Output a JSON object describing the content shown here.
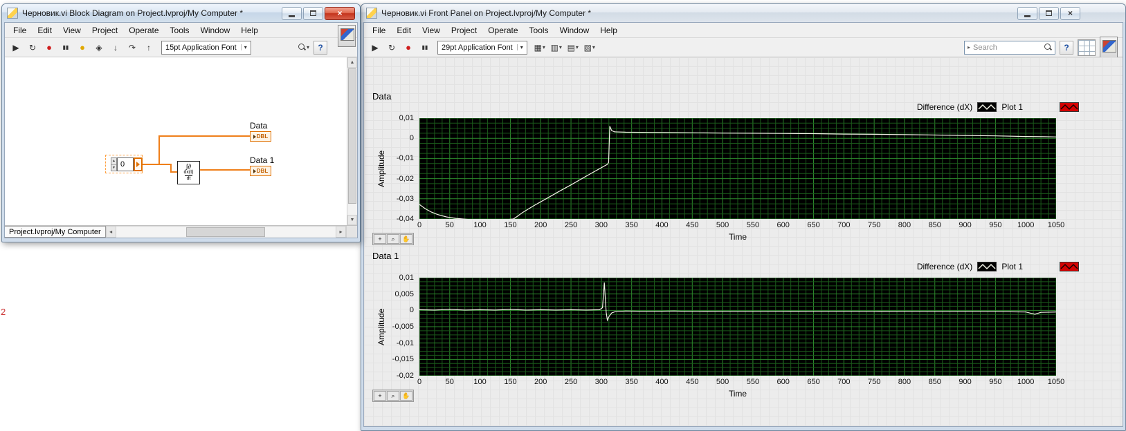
{
  "artifact": {
    "text": "2"
  },
  "block_diagram_window": {
    "title": "Черновик.vi Block Diagram on Project.lvproj/My Computer *",
    "menu": [
      "File",
      "Edit",
      "View",
      "Project",
      "Operate",
      "Tools",
      "Window",
      "Help"
    ],
    "toolbar": {
      "font_selector": "15pt Application Font",
      "icons": [
        "run",
        "run-continuous",
        "abort",
        "pause",
        "highlight-execution",
        "retain-wire-values",
        "step-into",
        "step-over",
        "step-out"
      ],
      "help_label": "?"
    },
    "diagram": {
      "control": {
        "value": "0"
      },
      "derivative_block": {
        "line1": "∫∂",
        "numerator": "dx(t)",
        "denominator": "dt"
      },
      "indicators": [
        {
          "label": "Data",
          "type": "DBL"
        },
        {
          "label": "Data 1",
          "type": "DBL"
        }
      ]
    },
    "bottom_tab": "Project.lvproj/My Computer"
  },
  "front_panel_window": {
    "title": "Черновик.vi Front Panel on Project.lvproj/My Computer *",
    "menu": [
      "File",
      "Edit",
      "View",
      "Project",
      "Operate",
      "Tools",
      "Window",
      "Help"
    ],
    "toolbar": {
      "font_selector": "29pt Application Font",
      "icons": [
        "run",
        "run-continuous",
        "abort",
        "pause"
      ],
      "layout_icons": [
        "align-objects",
        "distribute-objects",
        "text-settings",
        "reorder"
      ],
      "search_placeholder": "Search",
      "help_label": "?"
    }
  },
  "chart_data": [
    {
      "type": "line",
      "title": "Data",
      "xlabel": "Time",
      "ylabel": "Amplitude",
      "xlim": [
        0,
        1050
      ],
      "ylim": [
        -0.04,
        0.01
      ],
      "x_tick_step": 50,
      "x_tick_labels": [
        "0",
        "50",
        "100",
        "150",
        "200",
        "250",
        "300",
        "350",
        "400",
        "450",
        "500",
        "550",
        "600",
        "650",
        "700",
        "750",
        "800",
        "850",
        "900",
        "950",
        "1000",
        "1050"
      ],
      "y_ticks": [
        0.01,
        0,
        -0.01,
        -0.02,
        -0.03,
        -0.04
      ],
      "y_tick_labels": [
        "0,01",
        "0",
        "-0,01",
        "-0,02",
        "-0,03",
        "-0,04"
      ],
      "minor_divisions": 4,
      "grid": true,
      "legend_position": "top-right",
      "legend": [
        {
          "label": "Difference (dX)",
          "swatch_bg": "#000000",
          "swatch_line": "#f2f2e6"
        },
        {
          "label": "Plot 1",
          "swatch_bg": "#d40000",
          "swatch_line": "#1a0000"
        }
      ],
      "plot_bg": "#000000",
      "grid_color_major": "#2d8a2d",
      "grid_color_minor": "#1b5a1b",
      "line_color": "#f2f2e6",
      "series": [
        {
          "name": "Plot 1",
          "points": [
            [
              0,
              -0.0328
            ],
            [
              10,
              -0.035
            ],
            [
              20,
              -0.0366
            ],
            [
              30,
              -0.0378
            ],
            [
              45,
              -0.039
            ],
            [
              60,
              -0.0397
            ],
            [
              80,
              -0.0402
            ],
            [
              100,
              -0.0404
            ],
            [
              120,
              -0.0405
            ],
            [
              140,
              -0.0404
            ],
            [
              155,
              -0.04
            ],
            [
              160,
              -0.039
            ],
            [
              170,
              -0.0368
            ],
            [
              190,
              -0.0332
            ],
            [
              209,
              -0.03
            ],
            [
              230,
              -0.0264
            ],
            [
              250,
              -0.0231
            ],
            [
              268,
              -0.02
            ],
            [
              285,
              -0.0171
            ],
            [
              300,
              -0.0146
            ],
            [
              310,
              -0.0129
            ],
            [
              312,
              -0.012
            ],
            [
              314,
              0.006
            ],
            [
              317,
              0.0038
            ],
            [
              322,
              0.0032
            ],
            [
              340,
              0.003
            ],
            [
              380,
              0.0029
            ],
            [
              420,
              0.0028
            ],
            [
              460,
              0.0027
            ],
            [
              500,
              0.0026
            ],
            [
              550,
              0.0025
            ],
            [
              600,
              0.0024
            ],
            [
              650,
              0.0023
            ],
            [
              700,
              0.0021
            ],
            [
              750,
              0.002
            ],
            [
              800,
              0.0018
            ],
            [
              850,
              0.0016
            ],
            [
              900,
              0.0014
            ],
            [
              950,
              0.0012
            ],
            [
              1000,
              0.0009
            ],
            [
              1030,
              0.0008
            ],
            [
              1050,
              0.0007
            ]
          ]
        }
      ]
    },
    {
      "type": "line",
      "title": "Data 1",
      "xlabel": "Time",
      "ylabel": "Amplitude",
      "xlim": [
        0,
        1050
      ],
      "ylim": [
        -0.02,
        0.01
      ],
      "x_tick_step": 50,
      "x_tick_labels": [
        "0",
        "50",
        "100",
        "150",
        "200",
        "250",
        "300",
        "350",
        "400",
        "450",
        "500",
        "550",
        "600",
        "650",
        "700",
        "750",
        "800",
        "850",
        "900",
        "950",
        "1000",
        "1050"
      ],
      "y_ticks": [
        0.01,
        0.005,
        0,
        -0.005,
        -0.01,
        -0.015,
        -0.02
      ],
      "y_tick_labels": [
        "0,01",
        "0,005",
        "0",
        "-0,005",
        "-0,01",
        "-0,015",
        "-0,02"
      ],
      "minor_divisions": 4,
      "grid": true,
      "legend_position": "top-right",
      "legend": [
        {
          "label": "Difference (dX)",
          "swatch_bg": "#000000",
          "swatch_line": "#f2f2e6"
        },
        {
          "label": "Plot 1",
          "swatch_bg": "#d40000",
          "swatch_line": "#1a0000"
        }
      ],
      "plot_bg": "#000000",
      "grid_color_major": "#2d8a2d",
      "grid_color_minor": "#1b5a1b",
      "line_color": "#f2f2e6",
      "series": [
        {
          "name": "Plot 1",
          "points": [
            [
              0,
              0.0002
            ],
            [
              25,
              0.0001
            ],
            [
              50,
              0.0003
            ],
            [
              75,
              0.0001
            ],
            [
              100,
              0.0002
            ],
            [
              125,
              0.0001
            ],
            [
              150,
              0.0003
            ],
            [
              175,
              0.0001
            ],
            [
              200,
              0.0002
            ],
            [
              225,
              0.0001
            ],
            [
              250,
              0.0002
            ],
            [
              275,
              0.0001
            ],
            [
              297,
              0.0002
            ],
            [
              302,
              0.0008
            ],
            [
              305,
              0.0085
            ],
            [
              308,
              -0.0006
            ],
            [
              310,
              -0.003
            ],
            [
              313,
              -0.0018
            ],
            [
              317,
              -0.0008
            ],
            [
              323,
              -0.0004
            ],
            [
              340,
              -0.0002
            ],
            [
              380,
              -0.0003
            ],
            [
              420,
              -0.0002
            ],
            [
              460,
              -0.0004
            ],
            [
              500,
              -0.0003
            ],
            [
              550,
              -0.0004
            ],
            [
              600,
              -0.0003
            ],
            [
              650,
              -0.0004
            ],
            [
              700,
              -0.0003
            ],
            [
              750,
              -0.0004
            ],
            [
              800,
              -0.0003
            ],
            [
              850,
              -0.0004
            ],
            [
              900,
              -0.0003
            ],
            [
              950,
              -0.0004
            ],
            [
              1000,
              -0.0005
            ],
            [
              1015,
              -0.0012
            ],
            [
              1025,
              -0.0006
            ],
            [
              1050,
              -0.0005
            ]
          ]
        }
      ]
    }
  ]
}
